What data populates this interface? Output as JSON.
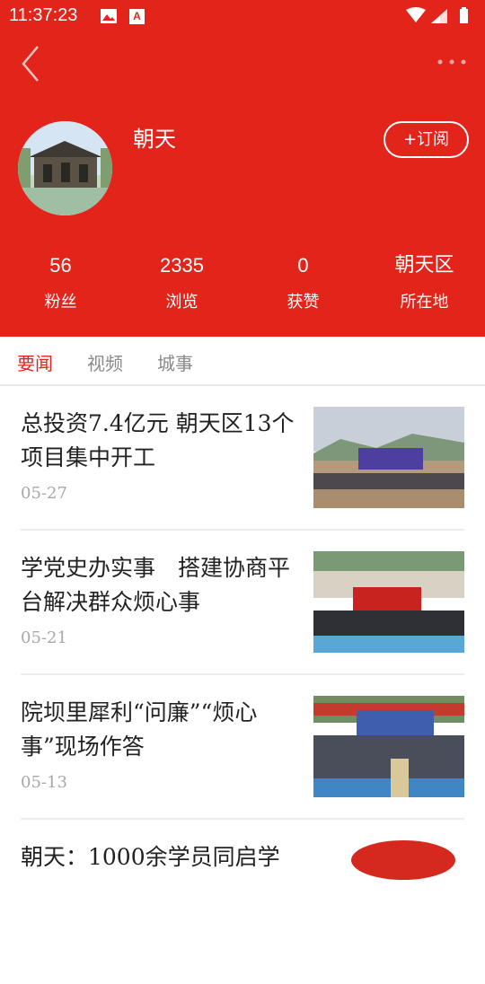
{
  "status_bar": {
    "time": "11:37:23",
    "badge_letter": "A"
  },
  "profile": {
    "name": "朝天",
    "subscribe_label": "+订阅"
  },
  "stats": [
    {
      "value": "56",
      "label": "粉丝"
    },
    {
      "value": "2335",
      "label": "浏览"
    },
    {
      "value": "0",
      "label": "获赞"
    },
    {
      "value": "朝天区",
      "label": "所在地"
    }
  ],
  "tabs": [
    {
      "label": "要闻",
      "active": true
    },
    {
      "label": "视频",
      "active": false
    },
    {
      "label": "城事",
      "active": false
    }
  ],
  "news": [
    {
      "title": "总投资7.4亿元 朝天区13个项目集中开工",
      "date": "05-27"
    },
    {
      "title": "学党史办实事　搭建协商平台解决群众烦心事",
      "date": "05-21"
    },
    {
      "title": "院坝里犀利“问廉”“烦心事”现场作答",
      "date": "05-13"
    },
    {
      "title": "朝天：1000余学员同启学",
      "date": ""
    }
  ],
  "colors": {
    "brand_red": "#e3241b",
    "text_dark": "#222222",
    "text_gray": "#a8a8a8",
    "tab_gray": "#8a8a8a"
  },
  "icons": [
    "image-icon",
    "a-badge-icon",
    "wifi-icon",
    "signal-icon",
    "battery-icon",
    "back-arrow-icon",
    "more-dots-icon"
  ]
}
